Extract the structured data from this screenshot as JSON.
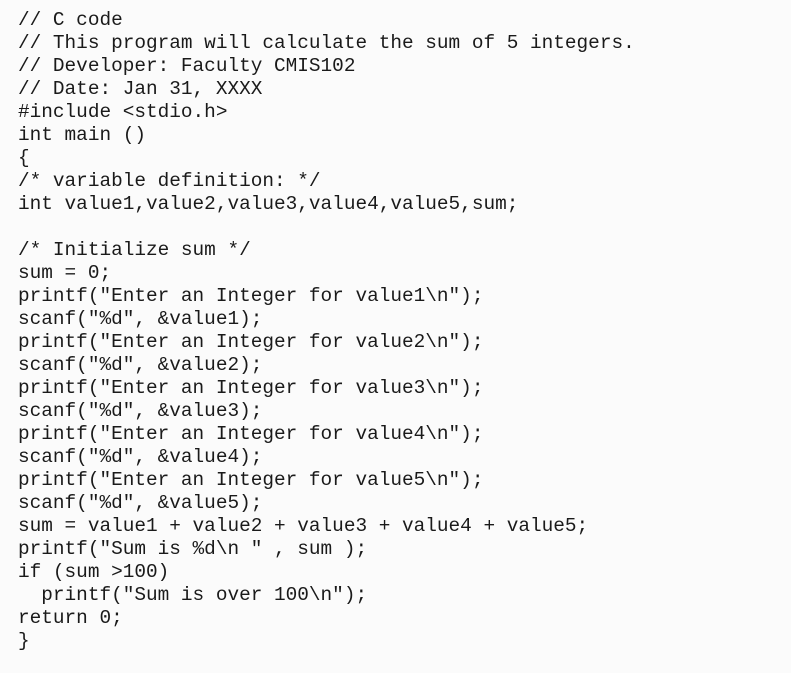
{
  "document": {
    "language": "C",
    "lines": [
      "// C code",
      "// This program will calculate the sum of 5 integers.",
      "// Developer: Faculty CMIS102",
      "// Date: Jan 31, XXXX",
      "#include <stdio.h>",
      "int main ()",
      "{",
      "/* variable definition: */",
      "int value1,value2,value3,value4,value5,sum;",
      "",
      "/* Initialize sum */",
      "sum = 0;",
      "printf(\"Enter an Integer for value1\\n\");",
      "scanf(\"%d\", &value1);",
      "printf(\"Enter an Integer for value2\\n\");",
      "scanf(\"%d\", &value2);",
      "printf(\"Enter an Integer for value3\\n\");",
      "scanf(\"%d\", &value3);",
      "printf(\"Enter an Integer for value4\\n\");",
      "scanf(\"%d\", &value4);",
      "printf(\"Enter an Integer for value5\\n\");",
      "scanf(\"%d\", &value5);",
      "sum = value1 + value2 + value3 + value4 + value5;",
      "printf(\"Sum is %d\\n \" , sum );",
      "if (sum >100)",
      "  printf(\"Sum is over 100\\n\");",
      "return 0;",
      "}"
    ]
  }
}
